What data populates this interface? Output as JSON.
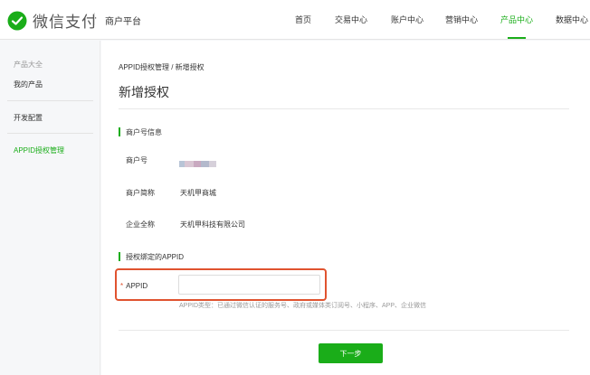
{
  "header": {
    "logo_text": "微信支付",
    "platform": "商户平台",
    "nav": [
      "首页",
      "交易中心",
      "账户中心",
      "营销中心",
      "产品中心",
      "数据中心"
    ],
    "active_nav": "产品中心"
  },
  "sidebar": {
    "group_label": "产品大全",
    "items": [
      {
        "label": "我的产品",
        "active": false
      },
      {
        "label": "开发配置",
        "active": false
      },
      {
        "label": "APPID授权管理",
        "active": true
      }
    ]
  },
  "main": {
    "breadcrumb": "APPID授权管理 / 新增授权",
    "title": "新增授权",
    "merchant_section": {
      "title": "商户号信息",
      "rows": [
        {
          "label": "商户号",
          "value": ""
        },
        {
          "label": "商户简称",
          "value": "天机甲商城"
        },
        {
          "label": "企业全称",
          "value": "天机甲科技有限公司"
        }
      ]
    },
    "appid_section": {
      "title": "授权绑定的APPID",
      "required_mark": "*",
      "field_label": "APPID",
      "value": "",
      "placeholder": "",
      "hint": "APPID类型：已通过微信认证的服务号、政府或媒体类订阅号、小程序、APP、企业微信"
    },
    "next_button": "下一步"
  },
  "colors": {
    "accent": "#1aad19",
    "highlight_border": "#e0532f"
  }
}
